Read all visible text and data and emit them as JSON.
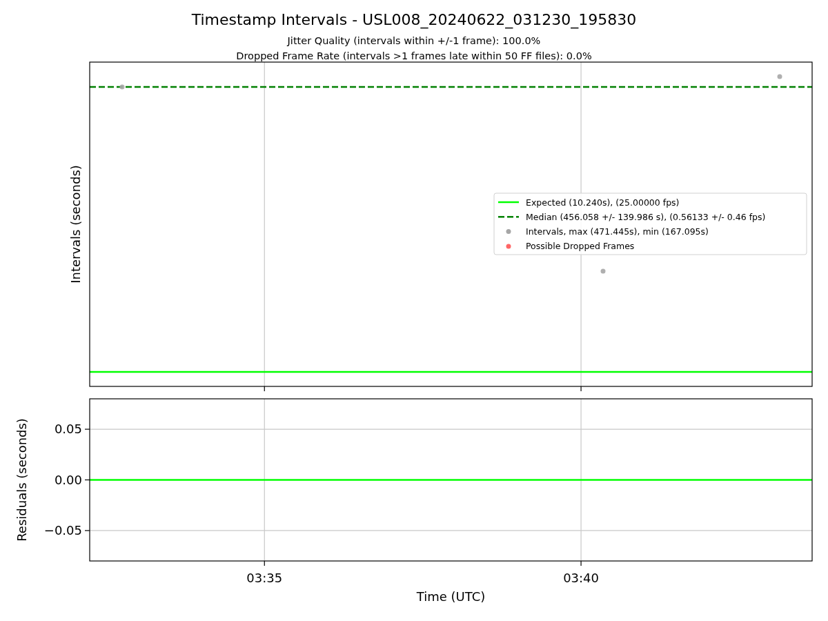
{
  "title": "Timestamp Intervals - USL008_20240622_031230_195830",
  "subtitles": [
    "Jitter Quality (intervals within +/-1 frame): 100.0%",
    "Dropped Frame Rate (intervals >1 frames late within 50 FF files): 0.0%"
  ],
  "intervals_plot": {
    "ylabel": "Intervals (seconds)",
    "legend": [
      {
        "kind": "line",
        "label": "Expected (10.240s), (25.00000 fps)",
        "color": "#00ff00"
      },
      {
        "kind": "dashed",
        "label": "Median (456.058 +/- 139.986 s), (0.56133 +/- 0.46 fps)",
        "color": "#008000"
      },
      {
        "kind": "marker",
        "label": "Intervals, max (471.445s), min (167.095s)",
        "color": "#a6a6a6"
      },
      {
        "kind": "marker",
        "label": "Possible Dropped Frames",
        "color": "#ff6666"
      }
    ]
  },
  "residuals_plot": {
    "chart_data": {
      "type": "line",
      "grid": true,
      "xlabel": "Time (UTC)",
      "ylabel": "Residuals (seconds)",
      "x": [
        212.24,
        223.65
      ],
      "series": [
        {
          "color": "#00ff00",
          "values": [
            0,
            0
          ]
        }
      ],
      "xlim": [
        212.24,
        223.65
      ],
      "ylim": [
        -0.08,
        0.08
      ],
      "xticks": [
        {
          "value": 215,
          "label": "03:35"
        },
        {
          "value": 220,
          "label": "03:40"
        }
      ],
      "yticks": [
        {
          "value": 0.05,
          "label": "0.05"
        },
        {
          "value": 0,
          "label": "0.00"
        },
        {
          "value": -0.05,
          "label": "−0.05"
        }
      ]
    }
  }
}
